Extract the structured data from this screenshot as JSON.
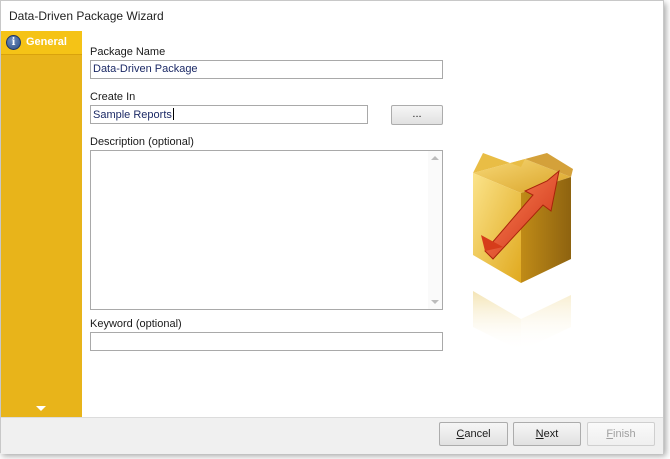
{
  "window": {
    "title": "Data-Driven Package Wizard"
  },
  "sidebar": {
    "items": [
      {
        "label": "General",
        "icon": "info-icon"
      }
    ]
  },
  "form": {
    "package_name": {
      "label": "Package Name",
      "value": "Data-Driven Package"
    },
    "create_in": {
      "label": "Create In",
      "value": "Sample Reports",
      "browse_label": "..."
    },
    "description": {
      "label": "Description (optional)",
      "value": ""
    },
    "keyword": {
      "label": "Keyword (optional)",
      "value": ""
    }
  },
  "footer": {
    "cancel": {
      "prefix": "",
      "accel": "C",
      "rest": "ancel"
    },
    "next": {
      "prefix": "",
      "accel": "N",
      "rest": "ext"
    },
    "finish": {
      "prefix": "",
      "accel": "F",
      "rest": "inish"
    }
  },
  "colors": {
    "sidebar": "#e8b41a",
    "sidebar_selected": "#f5c316",
    "input_text": "#1c2a66"
  }
}
